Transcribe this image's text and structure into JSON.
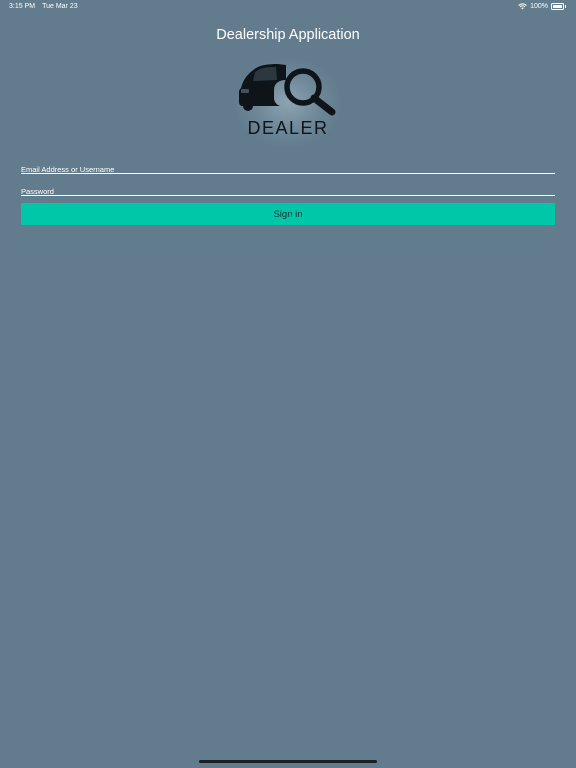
{
  "status_bar": {
    "time": "3:15 PM",
    "date": "Tue Mar 23",
    "battery_percent": "100%",
    "wifi_icon": "wifi-icon",
    "battery_icon": "battery-icon"
  },
  "header": {
    "title": "Dealership Application"
  },
  "logo": {
    "text": "DEALER",
    "icon": "car-magnifier-logo"
  },
  "form": {
    "email_placeholder": "Email Address or Username",
    "email_value": "",
    "password_placeholder": "Password",
    "password_value": "",
    "signin_label": "Sign in"
  },
  "colors": {
    "background": "#627c8d",
    "accent": "#00c7a8",
    "text": "#ffffff"
  }
}
